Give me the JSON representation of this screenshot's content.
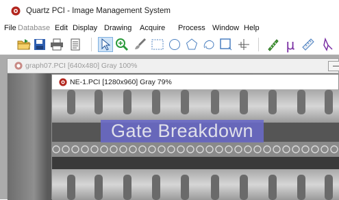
{
  "title": {
    "text": "Quartz PCI - Image Management System"
  },
  "menu": [
    {
      "label": "File",
      "enabled": true
    },
    {
      "label": "Database",
      "enabled": false
    },
    {
      "label": "Edit",
      "enabled": true
    },
    {
      "label": "Display",
      "enabled": true
    },
    {
      "label": "Drawing",
      "enabled": true
    },
    {
      "label": "Acquire",
      "enabled": true
    },
    {
      "label": "Process",
      "enabled": true
    },
    {
      "label": "Window",
      "enabled": true
    },
    {
      "label": "Help",
      "enabled": true
    }
  ],
  "toolbar": {
    "micro_label": "μ",
    "icons": [
      "open-folder-icon",
      "save-disk-icon",
      "print-icon",
      "document-icon",
      "pointer-arrow-icon",
      "zoom-icon",
      "brush-icon",
      "rectangle-select-icon",
      "circle-select-icon",
      "polygon-select-icon",
      "freehand-select-icon",
      "dashed-rectangle-icon",
      "crosshair-icon",
      "measure-icon",
      "micron-icon",
      "ruler-icon",
      "scale-icon"
    ]
  },
  "windows": {
    "back": {
      "title": "graph07.PCI [640x480] Gray 100%"
    },
    "front": {
      "title": "NE-1.PCI [1280x960] Gray 79%"
    }
  },
  "overlay": {
    "text": "Gate Breakdown"
  },
  "colors": {
    "accent_icon": "#c0392b",
    "overlay": "#6a6ac8",
    "pressed": "#cfe3f7"
  }
}
